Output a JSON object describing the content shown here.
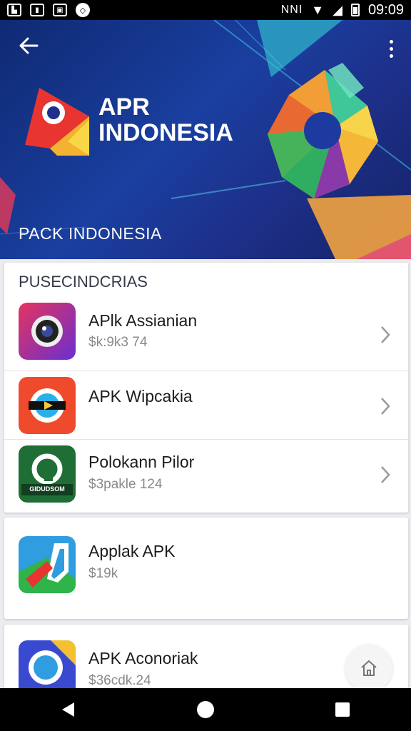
{
  "status_bar": {
    "signal_text": "NNI",
    "time": "09:09"
  },
  "header": {
    "brand_line1": "APR",
    "brand_line2": "INDONESIA",
    "subtitle": "PACK INDONESIA"
  },
  "section": {
    "title": "PUSECINDCRIAS"
  },
  "apps": [
    {
      "name": "APlk Assianian",
      "size": "$k:9k3 74"
    },
    {
      "name": "APK Wipcakia",
      "size": ""
    },
    {
      "name": "Polokann Pilor",
      "size": "$3pakle 124"
    }
  ],
  "app_icon_label": "GIDUDSOM",
  "card2_app": {
    "name": "Applak APK",
    "size": "$19k"
  },
  "card3_app": {
    "name": "APK Aconoriak",
    "size": "$36cdk.24"
  },
  "colors": {
    "hero_blue": "#1a3fa0",
    "status_black": "#000000",
    "card_white": "#ffffff"
  },
  "icons": [
    "back-arrow-icon",
    "more-vert-icon",
    "chevron-right-icon",
    "home-icon",
    "nav-back-icon",
    "nav-home-icon",
    "nav-recents-icon"
  ]
}
